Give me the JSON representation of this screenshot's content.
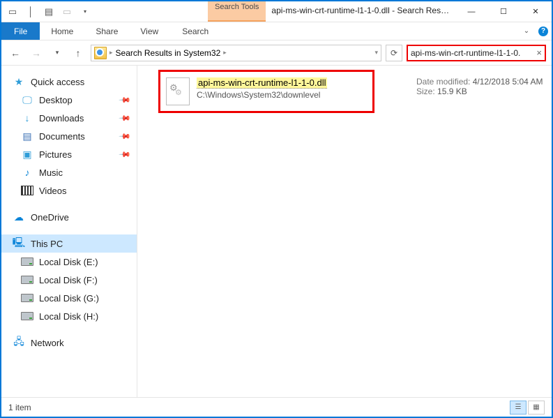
{
  "titlebar": {
    "search_tools_label": "Search Tools",
    "title": "api-ms-win-crt-runtime-l1-1-0.dll - Search Results in Syst..."
  },
  "ribbon": {
    "file": "File",
    "tabs": [
      "Home",
      "Share",
      "View"
    ],
    "search_tab": "Search"
  },
  "address": {
    "breadcrumb": "Search Results in System32",
    "search_value": "api-ms-win-crt-runtime-l1-1-0."
  },
  "nav": {
    "quick_access": "Quick access",
    "items": [
      {
        "label": "Desktop",
        "pin": true
      },
      {
        "label": "Downloads",
        "pin": true
      },
      {
        "label": "Documents",
        "pin": true
      },
      {
        "label": "Pictures",
        "pin": true
      },
      {
        "label": "Music",
        "pin": false
      },
      {
        "label": "Videos",
        "pin": false
      }
    ],
    "onedrive": "OneDrive",
    "thispc": "This PC",
    "drives": [
      {
        "label": "Local Disk (E:)"
      },
      {
        "label": "Local Disk (F:)"
      },
      {
        "label": "Local Disk (G:)"
      },
      {
        "label": "Local Disk (H:)"
      }
    ],
    "network": "Network"
  },
  "result": {
    "name": "api-ms-win-crt-runtime-l1-1-0.dll",
    "path": "C:\\Windows\\System32\\downlevel",
    "date_label": "Date modified:",
    "date": "4/12/2018 5:04 AM",
    "size_label": "Size:",
    "size": "15.9 KB"
  },
  "status": {
    "count": "1 item"
  }
}
